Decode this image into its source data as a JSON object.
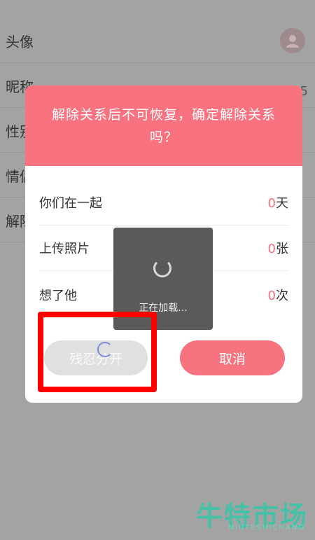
{
  "background": {
    "rows": [
      "头像",
      "昵称",
      "性别",
      "情侣",
      "解除"
    ],
    "right_text": "5"
  },
  "dialog": {
    "title": "解除关系后不可恢复，确定解除关系吗？",
    "stats": [
      {
        "label": "你们在一起",
        "value": "0",
        "unit": "天"
      },
      {
        "label": "上传照片",
        "value": "0",
        "unit": "张"
      },
      {
        "label": "想了他",
        "value": "0",
        "unit": "次"
      }
    ],
    "buttons": {
      "separate": "残忍分开",
      "cancel": "取消"
    }
  },
  "loading": {
    "text": "正在加载..."
  },
  "watermark": {
    "main": "牛特市场",
    "sub": "NIUTESHICHANG"
  },
  "colors": {
    "accent": "#f8737f",
    "highlight": "#ff0000",
    "watermark": "#42c3a7"
  }
}
